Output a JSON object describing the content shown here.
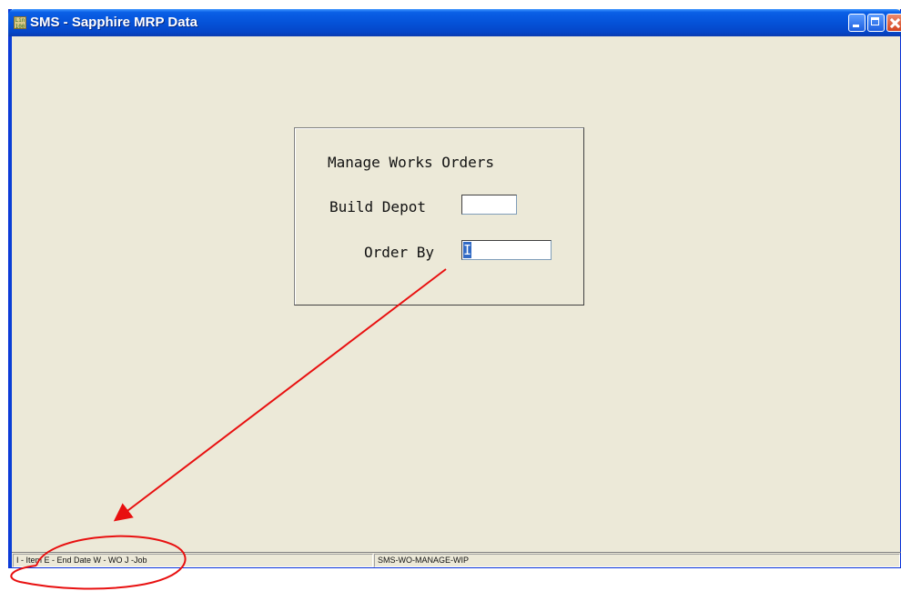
{
  "window": {
    "title": "SMS - Sapphire MRP Data",
    "icon_text": "Live 100"
  },
  "dialog": {
    "title": "Manage Works Orders",
    "build_depot_label": "Build Depot",
    "build_depot_value": "",
    "order_by_label": "Order By",
    "order_by_value": "I"
  },
  "statusbar": {
    "hint": "I - Item  E - End Date  W - WO  J -Job",
    "program_id": "SMS-WO-MANAGE-WIP"
  },
  "annotation": {
    "color": "#e81010"
  }
}
